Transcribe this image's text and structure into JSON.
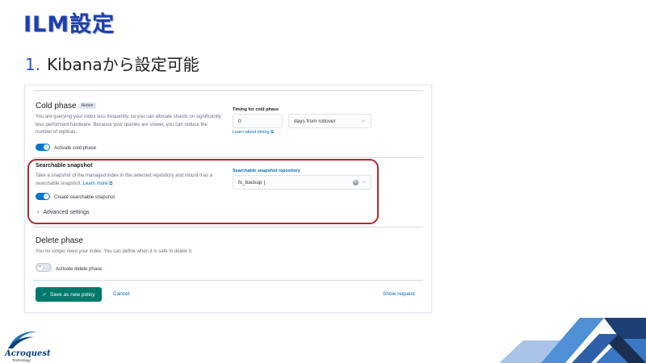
{
  "slide": {
    "title": "ILM設定",
    "subtitle_number": "1.",
    "subtitle_text": "Kibanaから設定可能"
  },
  "cold_phase": {
    "title": "Cold phase",
    "badge": "Active",
    "description": "You are querying your index less frequently, so you can allocate shards on significantly less performant hardware. Because your queries are slower, you can reduce the number of replicas.",
    "activate_label": "Activate cold phase",
    "activate_checked": true,
    "timing_label": "Timing for cold phase",
    "timing_value": "0",
    "timing_unit": "days from rollover",
    "learn_timing": "Learn about timing"
  },
  "searchable_snapshot": {
    "title": "Searchable snapshot",
    "description": "Take a snapshot of the managed index in the selected repository and mount it as a searchable snapshot.",
    "learn_more": "Learn more",
    "create_label": "Create searchable snapshot",
    "create_checked": true,
    "repo_label": "Searchable snapshot repository",
    "repo_value": "fs_backup",
    "advanced_label": "Advanced settings"
  },
  "delete_phase": {
    "title": "Delete phase",
    "description": "You no longer need your index. You can define when it is safe to delete it.",
    "activate_label": "Activate delete phase",
    "activate_checked": false
  },
  "footer": {
    "save_label": "Save as new policy",
    "cancel_label": "Cancel",
    "show_request_label": "Show request"
  },
  "branding": {
    "logo_name": "Acroquest",
    "logo_tagline": "Technology"
  },
  "icons": {
    "chevron": "chevron-down-icon",
    "check": "check-icon",
    "clear": "clear-icon",
    "external": "external-link-icon"
  },
  "colors": {
    "title": "#1e3fae",
    "accent": "#006bb8",
    "save_button": "#00796b",
    "highlight": "#b02a30"
  }
}
